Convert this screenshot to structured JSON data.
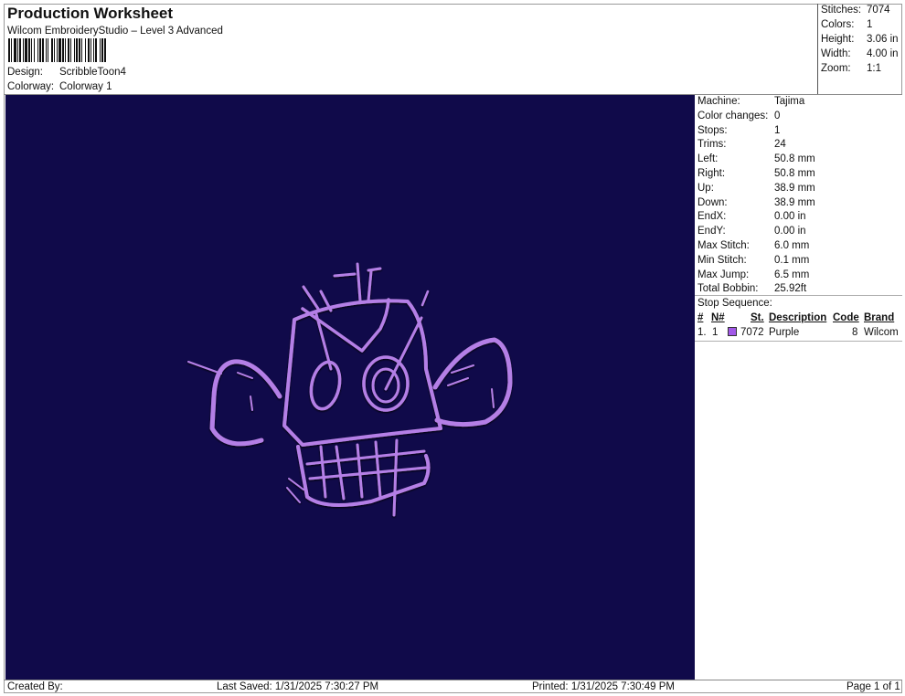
{
  "header": {
    "title": "Production Worksheet",
    "subtitle": "Wilcom EmbroideryStudio – Level 3 Advanced",
    "barcode_icon": "barcode-icon",
    "design_label": "Design:",
    "design_value": "ScribbleToon4",
    "colorway_label": "Colorway:",
    "colorway_value": "Colorway 1"
  },
  "summary": {
    "stitches_label": "Stitches:",
    "stitches_value": "7074",
    "colors_label": "Colors:",
    "colors_value": "1",
    "height_label": "Height:",
    "height_value": "3.06 in",
    "width_label": "Width:",
    "width_value": "4.00 in",
    "zoom_label": "Zoom:",
    "zoom_value": "1:1"
  },
  "canvas": {
    "background_color": "#100a4a",
    "thread_color": "#b47fe6",
    "design_icon": "embroidery-monkey-face-icon"
  },
  "details": [
    {
      "label": "Machine:",
      "value": "Tajima"
    },
    {
      "label": "Color changes:",
      "value": "0"
    },
    {
      "label": "Stops:",
      "value": "1"
    },
    {
      "label": "Trims:",
      "value": "24"
    },
    {
      "label": "Left:",
      "value": "50.8 mm"
    },
    {
      "label": "Right:",
      "value": "50.8 mm"
    },
    {
      "label": "Up:",
      "value": "38.9 mm"
    },
    {
      "label": "Down:",
      "value": "38.9 mm"
    },
    {
      "label": "EndX:",
      "value": "0.00 in"
    },
    {
      "label": "EndY:",
      "value": "0.00 in"
    },
    {
      "label": "Max Stitch:",
      "value": "6.0 mm"
    },
    {
      "label": "Min Stitch:",
      "value": "0.1 mm"
    },
    {
      "label": "Max Jump:",
      "value": "6.5 mm"
    },
    {
      "label": "Total Bobbin:",
      "value": "25.92ft"
    }
  ],
  "stop_sequence": {
    "title": "Stop Sequence:",
    "columns": [
      "#",
      "N#",
      "St.",
      "Description",
      "Code",
      "Brand"
    ],
    "rows": [
      {
        "index": "1.",
        "needle": "1",
        "swatch_color": "#a259e8",
        "stitches": "7072",
        "description": "Purple",
        "code": "8",
        "brand": "Wilcom"
      }
    ]
  },
  "footer": {
    "created_by": "Created By:",
    "last_saved": "Last Saved: 1/31/2025 7:30:27 PM",
    "printed": "Printed: 1/31/2025 7:30:49 PM",
    "page": "Page 1 of 1"
  }
}
